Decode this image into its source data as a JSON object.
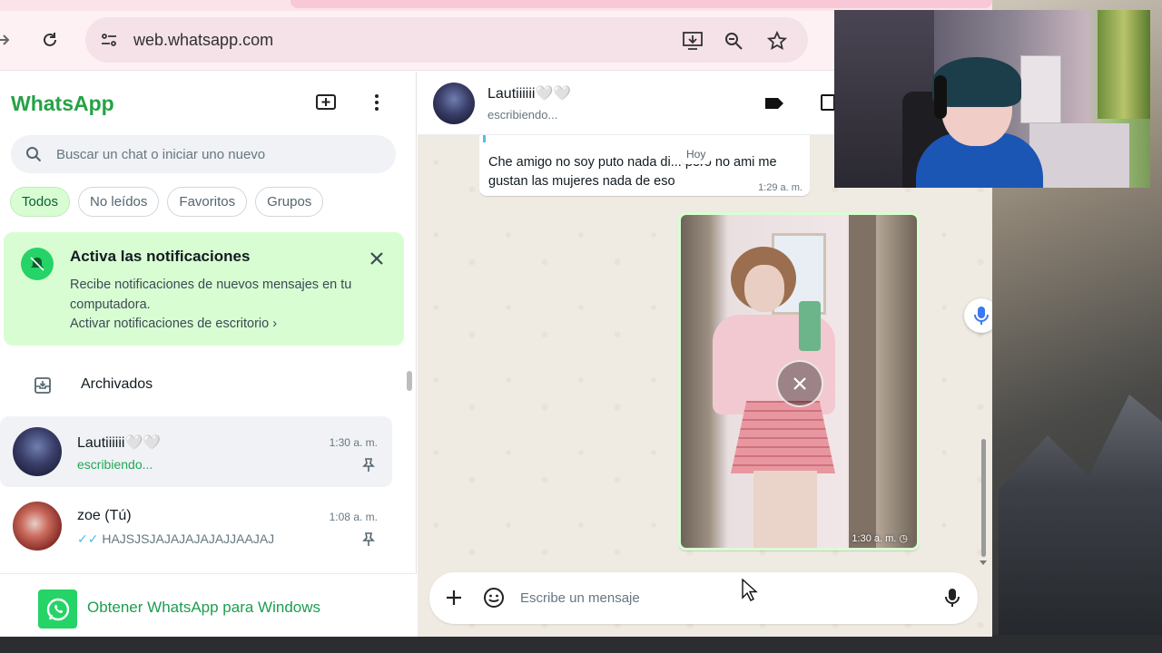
{
  "browser": {
    "url": "web.whatsapp.com"
  },
  "sidebar": {
    "title": "WhatsApp",
    "search_placeholder": "Buscar un chat o iniciar uno nuevo",
    "filters": [
      "Todos",
      "No leídos",
      "Favoritos",
      "Grupos"
    ],
    "active_filter": "Todos",
    "notification": {
      "title": "Activa las notificaciones",
      "body": "Recibe notificaciones de nuevos mensajes en tu computadora.",
      "link": "Activar notificaciones de escritorio"
    },
    "archived_label": "Archivados",
    "chats": [
      {
        "name": "Lautiiiiii🤍🤍",
        "time": "1:30 a. m.",
        "preview": "escribiendo...",
        "typing": true,
        "pinned": true,
        "selected": true
      },
      {
        "name": "zoe (Tú)",
        "time": "1:08 a. m.",
        "preview": "HAJSJSJAJAJAJAJAJJAAJAJ",
        "typing": false,
        "pinned": true,
        "selected": false
      }
    ],
    "get_app_label": "Obtener WhatsApp para Windows"
  },
  "conversation": {
    "contact_name": "Lautiiiiii🤍🤍",
    "contact_status": "escribiendo...",
    "date_badge": "Hoy",
    "incoming_message": {
      "text": "Che amigo no soy puto nada di... pero no ami me gustan las mujeres nada de eso",
      "time": "1:29 a. m."
    },
    "image_message": {
      "time": "1:30 a. m."
    },
    "composer_placeholder": "Escribe un mensaje"
  },
  "colors": {
    "brand_green": "#25a244",
    "notif_bg": "#d9fdd3",
    "chat_bg": "#efeae2",
    "typing_green": "#1fa855"
  }
}
